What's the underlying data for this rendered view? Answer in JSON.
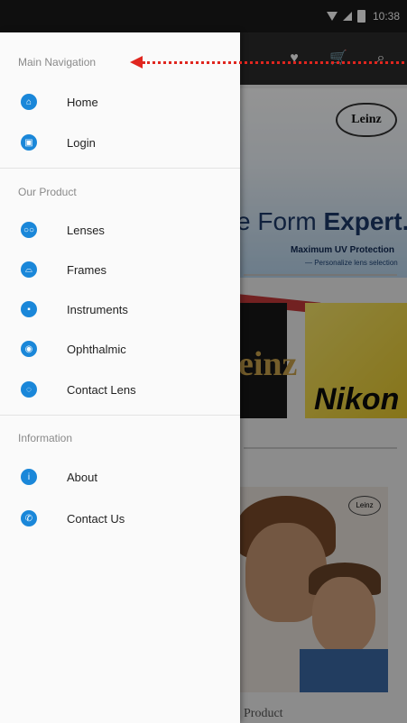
{
  "status_bar": {
    "time": "10:38"
  },
  "background": {
    "banner": {
      "logo_text": "Leinz",
      "headline_prefix": "e Form ",
      "headline_bold": "Expert.",
      "subline": "Maximum UV Protection",
      "tagline": "— Personalize lens selection"
    },
    "tiles": {
      "left_text": "einz",
      "right_text": "Nikon"
    },
    "poster": {
      "logo_text": "Leinz",
      "caption": "Product"
    }
  },
  "drawer": {
    "sections": [
      {
        "header": "Main Navigation",
        "items": [
          {
            "label": "Home",
            "icon": "home-icon"
          },
          {
            "label": "Login",
            "icon": "lock-icon"
          }
        ]
      },
      {
        "header": "Our Product",
        "items": [
          {
            "label": "Lenses",
            "icon": "lenses-icon"
          },
          {
            "label": "Frames",
            "icon": "frames-icon"
          },
          {
            "label": "Instruments",
            "icon": "instruments-icon"
          },
          {
            "label": "Ophthalmic",
            "icon": "ophthalmic-icon"
          },
          {
            "label": "Contact Lens",
            "icon": "contact-lens-icon"
          }
        ]
      },
      {
        "header": "Information",
        "items": [
          {
            "label": "About",
            "icon": "info-icon"
          },
          {
            "label": "Contact Us",
            "icon": "phone-icon"
          }
        ]
      }
    ]
  },
  "colors": {
    "accent": "#1a87d9",
    "annotation": "#e0261f",
    "toolbar": "#2b2b2b"
  }
}
